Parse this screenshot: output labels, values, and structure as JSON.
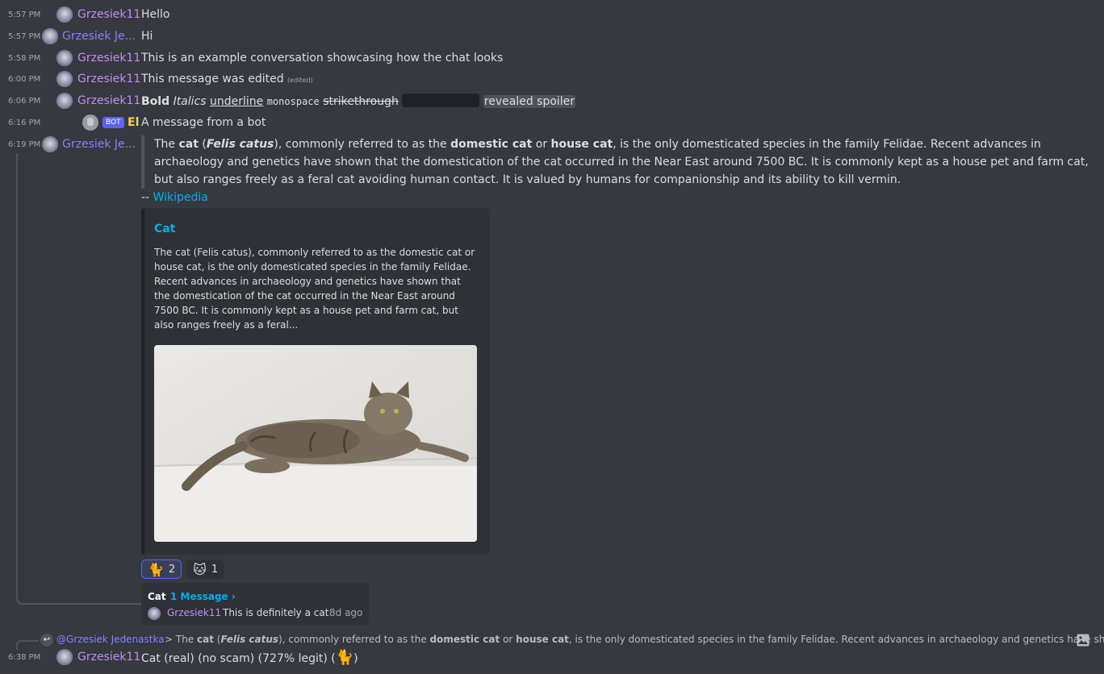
{
  "messages": [
    {
      "time": "5:57 PM",
      "user": "Grzesiek11",
      "text": "Hello"
    },
    {
      "time": "5:57 PM",
      "user": "Grzesiek Je...",
      "text": "Hi"
    },
    {
      "time": "5:58 PM",
      "user": "Grzesiek11",
      "text": "This is an example conversation showcasing how the chat looks"
    },
    {
      "time": "6:00 PM",
      "user": "Grzesiek11",
      "text": "This message was edited",
      "edited": "(edited)"
    },
    {
      "time": "6:06 PM",
      "user": "Grzesiek11",
      "bold": "Bold",
      "italics": "Italics",
      "underline": "underline",
      "monospace": "monospace",
      "strikethrough": "strikethrough",
      "spoiler": "revealed spoiler"
    },
    {
      "time": "6:16 PM",
      "user": "El",
      "badge": "BOT",
      "text": "A message from a bot"
    },
    {
      "time": "6:19 PM",
      "user": "Grzesiek Je..."
    }
  ],
  "quote": {
    "w1": "The ",
    "b1": "cat",
    "w2": " (",
    "bi": "Felis catus",
    "w3": "), commonly referred to as the ",
    "b2": "domestic cat",
    "w4": " or ",
    "b3": "house cat",
    "w5": ", is the only domesticated species in the family Felidae. Recent advances in archaeology and genetics have shown that the domestication of the cat occurred in the Near East around 7500 BC. It is commonly kept as a house pet and farm cat, but also ranges freely as a feral cat avoiding human contact. It is valued by humans for companionship and its ability to kill vermin."
  },
  "source": {
    "prefix": "-- ",
    "link": "Wikipedia"
  },
  "embed": {
    "title": "Cat",
    "description": "The cat (Felis catus), commonly referred to as the domestic cat or house cat, is the only domesticated species in the family Felidae. Recent advances in archaeology and genetics have shown that the domestication of the cat occurred in the Near East around 7500 BC. It is commonly kept as a house pet and farm cat, but also ranges freely as a feral..."
  },
  "reactions": [
    {
      "emoji": "🐈",
      "count": "2"
    },
    {
      "emoji": "🐱",
      "count": "1"
    }
  ],
  "thread": {
    "name": "Cat",
    "count": "1 Message ›",
    "user": "Grzesiek11",
    "text": "This is definitely a cat",
    "time": "8d ago"
  },
  "reply": {
    "user": "@Grzesiek Jedenastka",
    "t1": "> The ",
    "b1": "cat",
    "t2": " (",
    "bi": "Felis catus",
    "t3": "), commonly referred to as the ",
    "b2": "domestic cat",
    "t4": " or ",
    "b3": "house cat",
    "t5": ", is the only domesticated species in the family Felidae. Recent advances in archaeology and genetics have shown"
  },
  "last": {
    "time": "6:38 PM",
    "user": "Grzesiek11",
    "text": "Cat (real) (no scam) (727% legit) (",
    "emoji": "🐈",
    "close": ")"
  },
  "colors": {
    "background": "#36393f",
    "link": "#00aff4",
    "user_purple": "#c18df2",
    "user_blue": "#8f7dff",
    "bot_name": "#f5d552",
    "bot_badge": "#5865f2"
  }
}
